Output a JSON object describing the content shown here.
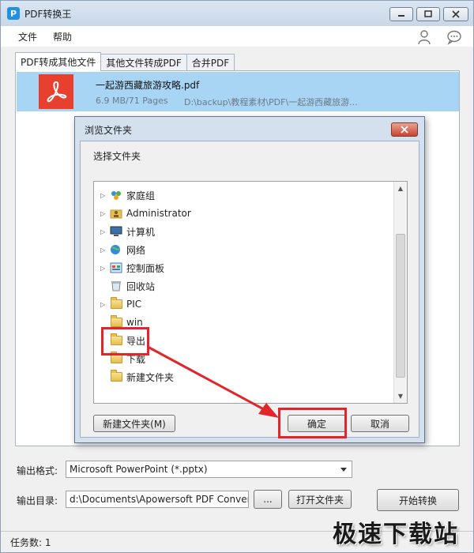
{
  "app": {
    "title": "PDF转换王"
  },
  "menu": [
    "文件",
    "帮助"
  ],
  "tabs": [
    "PDF转成其他文件",
    "其他文件转成PDF",
    "合并PDF"
  ],
  "file": {
    "name": "一起游西藏旅游攻略.pdf",
    "meta": "6.9 MB/71 Pages",
    "path": "D:\\backup\\教程素材\\PDF\\一起游西藏旅游..."
  },
  "dialog": {
    "title": "浏览文件夹",
    "label": "选择文件夹",
    "tree": [
      "家庭组",
      "Administrator",
      "计算机",
      "网络",
      "控制面板",
      "回收站",
      "PIC",
      "win",
      "导出",
      "下载",
      "新建文件夹"
    ],
    "new_folder_label": "新建文件夹(M)",
    "ok_label": "确定",
    "cancel_label": "取消"
  },
  "form": {
    "format_label": "输出格式:",
    "format_value": "Microsoft PowerPoint (*.pptx)",
    "dir_label": "输出目录:",
    "dir_value": "d:\\Documents\\Apowersoft PDF Convert",
    "browse_label": "...",
    "open_folder_label": "打开文件夹",
    "start_label": "开始转换"
  },
  "status": {
    "text": "任务数: 1"
  },
  "watermark": "极速下载站",
  "colors": {
    "selection": "#a9d5f5",
    "highlight": "#e0262b",
    "pdf_red": "#e8402f"
  }
}
